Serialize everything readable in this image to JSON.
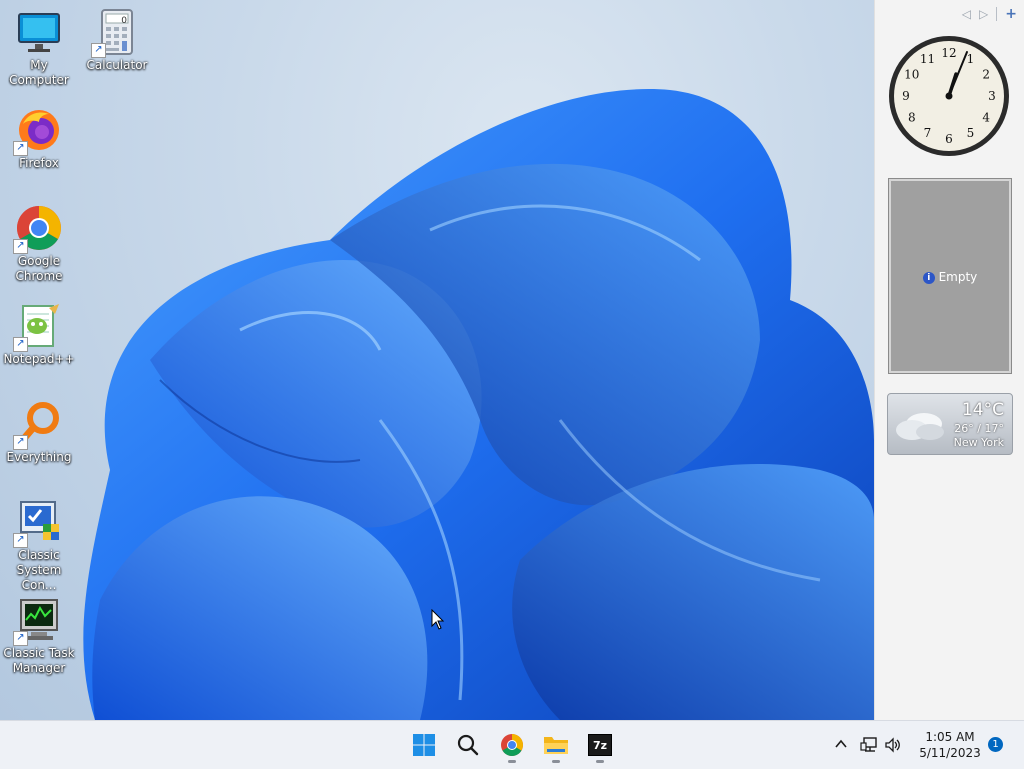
{
  "desktop": {
    "icons": [
      {
        "label": "My Computer",
        "icon": "monitor-icon",
        "shortcut": false
      },
      {
        "label": "Calculator",
        "icon": "calculator-icon",
        "shortcut": true
      },
      {
        "label": "Firefox",
        "icon": "firefox-icon",
        "shortcut": true
      },
      {
        "label": "Google Chrome",
        "icon": "chrome-icon",
        "shortcut": true
      },
      {
        "label": "Notepad++",
        "icon": "notepadpp-icon",
        "shortcut": true
      },
      {
        "label": "Everything",
        "icon": "everything-search-icon",
        "shortcut": true
      },
      {
        "label": "Classic System Con...",
        "icon": "control-panel-icon",
        "shortcut": true
      },
      {
        "label": "Classic Task Manager",
        "icon": "task-manager-icon",
        "shortcut": true
      }
    ],
    "calculator_display": "0"
  },
  "sidebar": {
    "nav": {
      "prev": "◁",
      "next": "▷",
      "add": "+"
    },
    "clock": {
      "numbers": [
        "12",
        "1",
        "2",
        "3",
        "4",
        "5",
        "6",
        "7",
        "8",
        "9",
        "10",
        "11"
      ]
    },
    "slideshow": {
      "status": "Empty",
      "info_icon": "i"
    },
    "weather": {
      "temp": "14°C",
      "range": "26° / 17°",
      "city": "New York",
      "condition_icon": "cloudy-icon"
    }
  },
  "taskbar": {
    "apps": [
      "start-icon",
      "search-icon",
      "chrome-icon",
      "file-explorer-icon",
      "7zip-icon"
    ],
    "sevenzip_label": "7z",
    "tray": {
      "chevron": "^",
      "time": "1:05 AM",
      "date": "5/11/2023",
      "notification_count": "1"
    }
  },
  "colors": {
    "accent": "#0067c0",
    "bloom_light": "#3b8cff",
    "bloom_dark": "#0a3fb8"
  }
}
